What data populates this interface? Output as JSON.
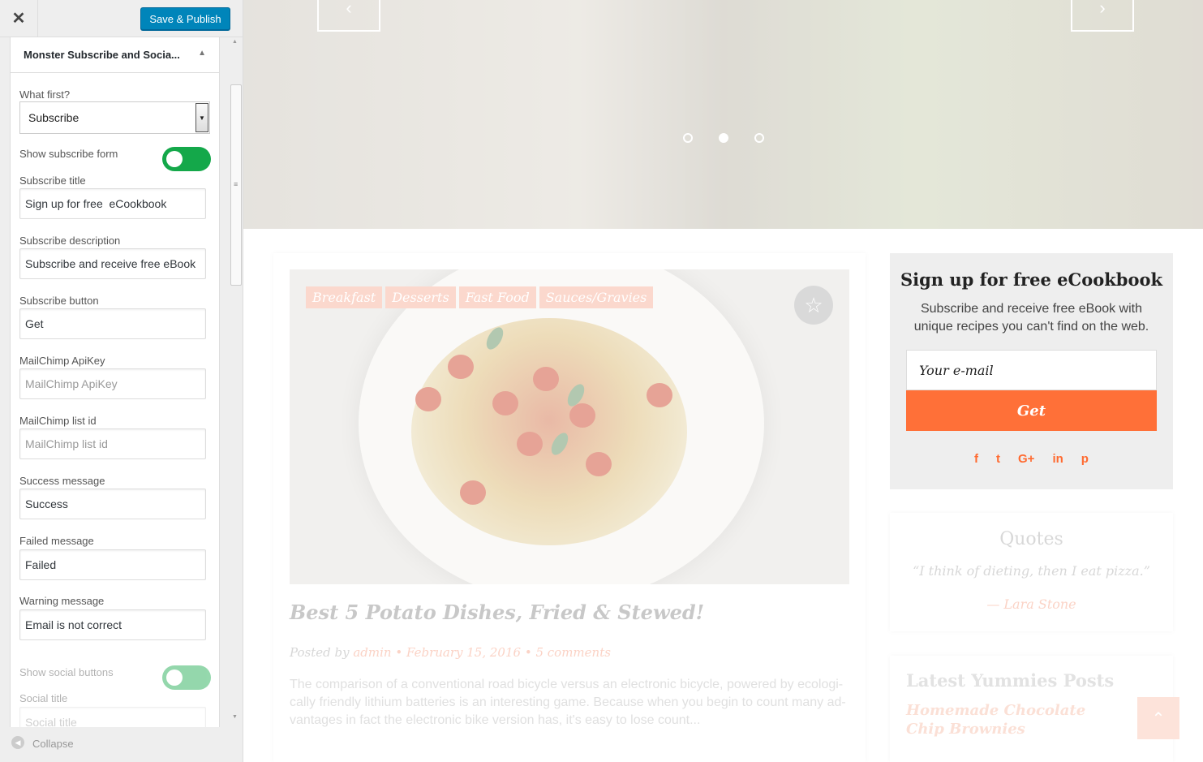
{
  "customizer": {
    "close_label": "✕",
    "publish_label": "Save & Publish",
    "section_title": "Monster Subscribe and Socia...",
    "controls": {
      "what_first_label": "What first?",
      "what_first_value": "Subscribe",
      "show_subscribe_label": "Show subscribe form",
      "subscribe_title_label": "Subscribe title",
      "subscribe_title_value": "Sign up for free  eCookbook",
      "subscribe_desc_label": "Subscribe description",
      "subscribe_desc_value": "Subscribe and receive free eBook",
      "subscribe_button_label": "Subscribe button",
      "subscribe_button_value": "Get",
      "mailchimp_key_label": "MailChimp ApiKey",
      "mailchimp_key_placeholder": "MailChimp ApiKey",
      "mailchimp_list_label": "MailChimp list id",
      "mailchimp_list_placeholder": "MailChimp list id",
      "success_label": "Success message",
      "success_value": "Success",
      "failed_label": "Failed message",
      "failed_value": "Failed",
      "warning_label": "Warning message",
      "warning_value": "Email is not correct",
      "show_social_label": "Show social buttons",
      "social_title_label": "Social title",
      "social_title_placeholder": "Social title"
    },
    "collapse_label": "Collapse",
    "accent_color": "#0085ba",
    "toggle_color": "#14a84a"
  },
  "preview": {
    "post": {
      "tags": [
        "Breakfast",
        "Desserts",
        "Fast Food",
        "Sauces/Gravies"
      ],
      "title": "Best 5 Potato Dishes, Fried & Stewed!",
      "posted_by": "Posted by",
      "author": "admin",
      "date": "February 15, 2016",
      "comments": "5 comments",
      "excerpt": "The comparison of a conventional road bicycle versus an electronic bicycle, powered by ecologi-cally friendly lithium batteries is an interesting game. Because when you begin to count many ad-vantages in fact the electronic bike version has, it's easy to lose count..."
    },
    "subscribe_widget": {
      "title": "Sign up for free eCookbook",
      "description": "Subscribe and receive free eBook with unique recipes you can't find on the web.",
      "email_placeholder": "Your e-mail",
      "button": "Get",
      "social": [
        "f",
        "t",
        "G+",
        "in",
        "p"
      ],
      "button_color": "#ff7038"
    },
    "quotes_widget": {
      "title": "Quotes",
      "quote": "“I think of dieting, then I eat pizza.”",
      "author": "— Lara Stone"
    },
    "latest_widget": {
      "title": "Latest Yummies Posts",
      "item": "Homemade Chocolate Chip Brownies"
    }
  }
}
